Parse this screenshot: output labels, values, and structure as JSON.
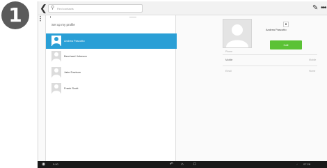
{
  "step_badge": "1",
  "topbar": {
    "search_placeholder": "Find contacts"
  },
  "contact_list": {
    "setup_label": "Set up my profile",
    "items": [
      {
        "name": "Andrea Pascotto",
        "selected": true
      },
      {
        "name": "Bernhard Johnson",
        "selected": false
      },
      {
        "name": "Jake Davison",
        "selected": false
      },
      {
        "name": "Frank Scott",
        "selected": false
      }
    ]
  },
  "detail": {
    "contact_name": "Andrea Pascotto",
    "call_label": "Call",
    "section_label": "Phone",
    "rows": [
      {
        "label": "Mobile",
        "value": "Mobile"
      },
      {
        "label": "Email",
        "value": "Home"
      }
    ]
  },
  "navbar": {
    "left_text": "0:00",
    "time": "07:28"
  },
  "colors": {
    "selected_row": "#2a9fd6",
    "call_button": "#5bc236",
    "navbar": "#1a1a1a"
  }
}
